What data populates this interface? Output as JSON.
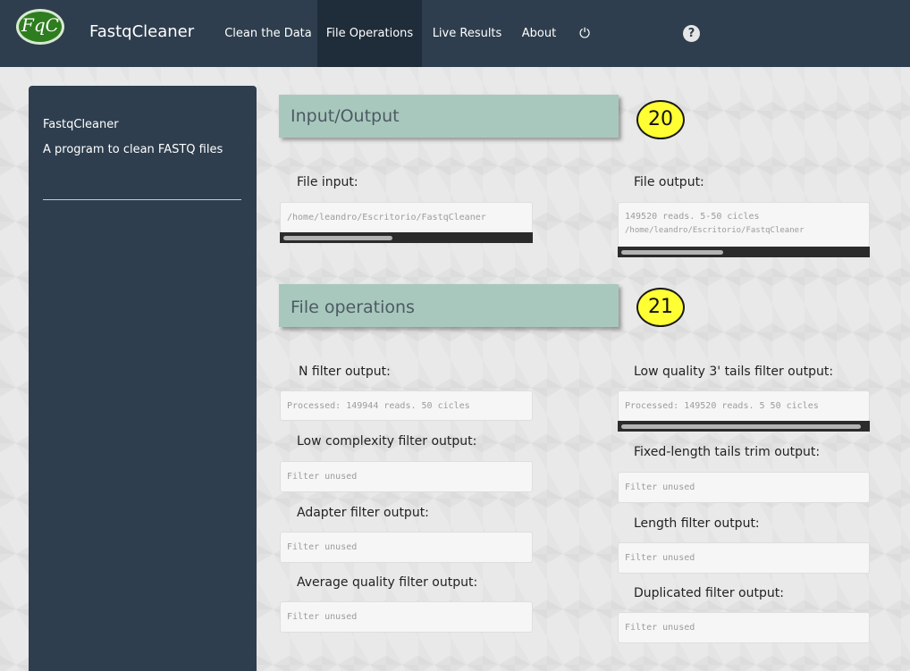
{
  "app": {
    "logo_text": "FqC",
    "brand": "FastqCleaner"
  },
  "nav": {
    "items": [
      {
        "label": "Clean the Data"
      },
      {
        "label": "File Operations"
      },
      {
        "label": "Live Results"
      },
      {
        "label": "About"
      }
    ],
    "active": "File Operations",
    "power_icon": "⏻",
    "help_icon": "?"
  },
  "sidebar": {
    "title": "FastqCleaner",
    "subtitle": "A program to clean FASTQ files"
  },
  "sections": {
    "io": {
      "title": "Input/Output",
      "badge": "20",
      "file_input_label": "File input:",
      "file_input_value": "/home/leandro/Escritorio/FastqCleaner",
      "file_output_label": "File output:",
      "file_output_line1": "149520 reads. 5-50 cicles",
      "file_output_line2": "/home/leandro/Escritorio/FastqCleaner"
    },
    "ops": {
      "title": "File operations",
      "badge": "21",
      "n_filter_label": "N filter output:",
      "n_filter_value": "Processed: 149944 reads. 50 cicles",
      "low_complexity_label": "Low complexity filter output:",
      "low_complexity_value": "Filter unused",
      "adapter_label": "Adapter filter output:",
      "adapter_value": "Filter unused",
      "avg_quality_label": "Average quality filter output:",
      "avg_quality_value": "Filter unused",
      "low_quality_tails_label": "Low quality 3' tails filter output:",
      "low_quality_tails_value": "Processed: 149520 reads. 5 50 cicles",
      "fixed_length_label": "Fixed-length tails trim output:",
      "fixed_length_value": "Filter unused",
      "length_label": "Length filter output:",
      "length_value": "Filter unused",
      "duplicated_label": "Duplicated filter output:",
      "duplicated_value": "Filter unused"
    }
  },
  "colors": {
    "navbar": "#2e3e4e",
    "section_header": "#a9c8bd",
    "badge": "#ffff33"
  }
}
